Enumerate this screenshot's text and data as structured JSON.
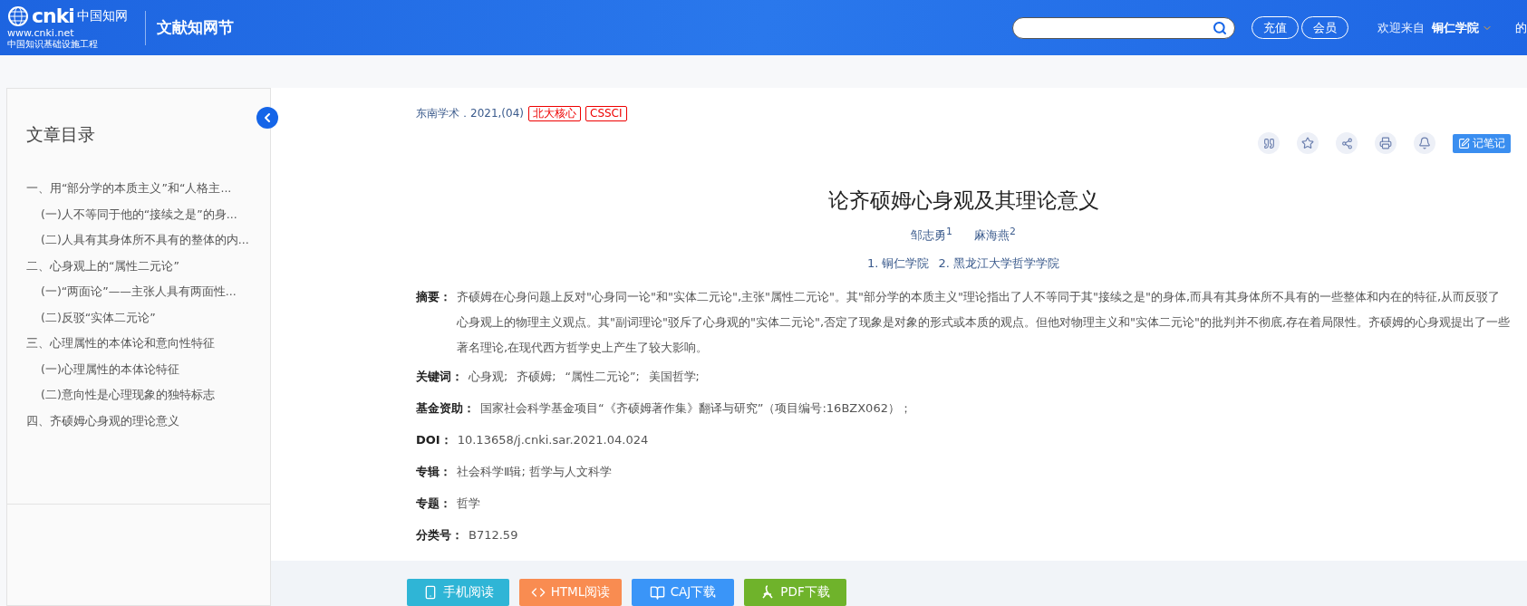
{
  "header": {
    "logo": {
      "mark": "cnki",
      "brand": "中国知网",
      "url": "www.cnki.net",
      "slogan": "中国知识基础设施工程"
    },
    "section": "文献知网节",
    "buttons": [
      "充值",
      "会员"
    ],
    "welcome": "欢迎来自",
    "institution": "铜仁学院",
    "trailing": "的"
  },
  "toc": {
    "title": "文章目录",
    "items": [
      {
        "label": "一、用“部分学的本质主义”和“人格主...",
        "children": [
          {
            "label": "(一)人不等同于他的“接续之是”的身..."
          },
          {
            "label": "(二)人具有其身体所不具有的整体的内..."
          }
        ]
      },
      {
        "label": "二、心身观上的“属性二元论”",
        "children": [
          {
            "label": "(一)“两面论”——主张人具有两面性..."
          },
          {
            "label": "(二)反驳“实体二元论”"
          }
        ]
      },
      {
        "label": "三、心理属性的本体论和意向性特征",
        "children": [
          {
            "label": "(一)心理属性的本体论特征"
          },
          {
            "label": "(二)意向性是心理现象的独特标志"
          }
        ]
      },
      {
        "label": "四、齐硕姆心身观的理论意义"
      }
    ]
  },
  "article": {
    "source": "东南学术．2021,(04)",
    "tags": [
      "北大核心",
      "CSSCI"
    ],
    "tools": [
      {
        "kind": "quote"
      },
      {
        "kind": "star"
      },
      {
        "kind": "share"
      },
      {
        "kind": "print"
      },
      {
        "kind": "bell"
      }
    ],
    "note_button": "记笔记",
    "title": "论齐硕姆心身观及其理论意义",
    "authors": [
      "邹志勇$^{1}$",
      "麻海燕$^{2}$"
    ],
    "affiliations": [
      "1. 铜仁学院",
      "2. 黑龙江大学哲学学院"
    ],
    "fields": [
      {
        "kind": "text",
        "label": "摘要：",
        "value": "齐硕姆在心身问题上反对\"心身同一论\"和\"实体二元论\",主张\"属性二元论\"。其\"部分学的本质主义\"理论指出了人不等同于其\"接续之是\"的身体,而具有其身体所不具有的一些整体和内在的特征,从而反驳了心身观上的物理主义观点。其\"副词理论\"驳斥了心身观的\"实体二元论\",否定了现象是对象的形式或本质的观点。但他对物理主义和\"实体二元论\"的批判并不彻底,存在着局限性。齐硕姆的心身观提出了一些著名理论,在现代西方哲学史上产生了较大影响。"
      },
      {
        "kind": "keywords",
        "label": "关键词：",
        "items": [
          "心身观;",
          "齐硕姆;",
          "“属性二元论”;",
          "美国哲学;"
        ]
      },
      {
        "kind": "text",
        "label": "基金资助：",
        "value": "国家社会科学基金项目“《齐硕姆著作集》翻译与研究”（项目编号:16BZX062）；"
      },
      {
        "kind": "text",
        "label": "DOI：",
        "value": "10.13658/j.cnki.sar.2021.04.024"
      },
      {
        "kind": "text",
        "label": "专辑：",
        "value": "社会科学Ⅱ辑; 哲学与人文科学"
      },
      {
        "kind": "text",
        "label": "专题：",
        "value": "哲学"
      },
      {
        "kind": "text",
        "label": "分类号：",
        "value": "B712.59"
      }
    ]
  },
  "downloads": [
    {
      "kind": "phone",
      "label": "手机阅读",
      "color": "#2fb5d6"
    },
    {
      "kind": "html",
      "label": "HTML阅读",
      "color": "#f98c51"
    },
    {
      "kind": "caj",
      "label": "CAJ下载",
      "color": "#3a95f8"
    },
    {
      "kind": "pdf",
      "label": "PDF下载",
      "color": "#6fb32b"
    }
  ]
}
